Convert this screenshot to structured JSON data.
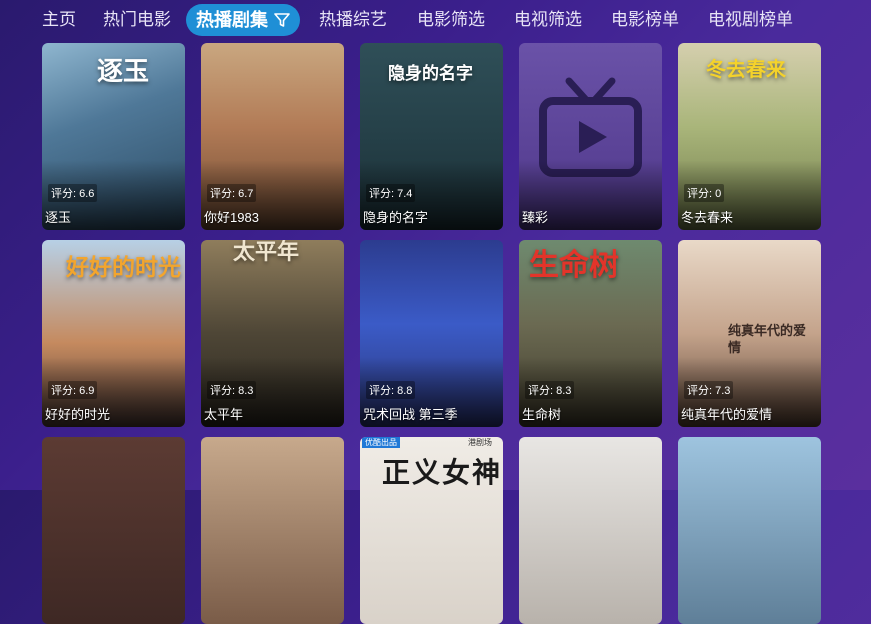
{
  "nav": {
    "tabs": [
      {
        "label": "主页"
      },
      {
        "label": "热门电影"
      },
      {
        "label": "热播剧集",
        "active": true
      },
      {
        "label": "热播综艺"
      },
      {
        "label": "电影筛选"
      },
      {
        "label": "电视筛选"
      },
      {
        "label": "电影榜单"
      },
      {
        "label": "电视剧榜单"
      }
    ],
    "filter_icon": "filter-icon"
  },
  "shows": [
    {
      "title": "逐玉",
      "rating": "评分: 6.6",
      "poster_text": "逐玉"
    },
    {
      "title": "你好1983",
      "rating": "评分: 6.7"
    },
    {
      "title": "隐身的名字",
      "rating": "评分: 7.4",
      "poster_text": "隐身的名字"
    },
    {
      "title": "臻彩",
      "rating": "",
      "icon": "tv-play-icon"
    },
    {
      "title": "冬去春来",
      "rating": "评分: 0",
      "poster_text": "冬去春来"
    },
    {
      "title": "好好的时光",
      "rating": "评分: 6.9",
      "poster_text": "好好的时光"
    },
    {
      "title": "太平年",
      "rating": "评分: 8.3",
      "poster_text": "太平年"
    },
    {
      "title": "咒术回战 第三季",
      "rating": "评分: 8.8"
    },
    {
      "title": "生命树",
      "rating": "评分: 8.3",
      "poster_text": "生命树"
    },
    {
      "title": "纯真年代的爱情",
      "rating": "评分: 7.3",
      "poster_text": "纯真年代的爱情"
    },
    {
      "title": "",
      "rating": ""
    },
    {
      "title": "",
      "rating": ""
    },
    {
      "title": "",
      "rating": "",
      "poster_text": "正义女神",
      "badge": "优酷出品",
      "badge2": "港剧场"
    },
    {
      "title": "",
      "rating": ""
    },
    {
      "title": "",
      "rating": ""
    }
  ],
  "colors": {
    "accent": "#1f8fd6",
    "background": "#3b1f8c"
  }
}
